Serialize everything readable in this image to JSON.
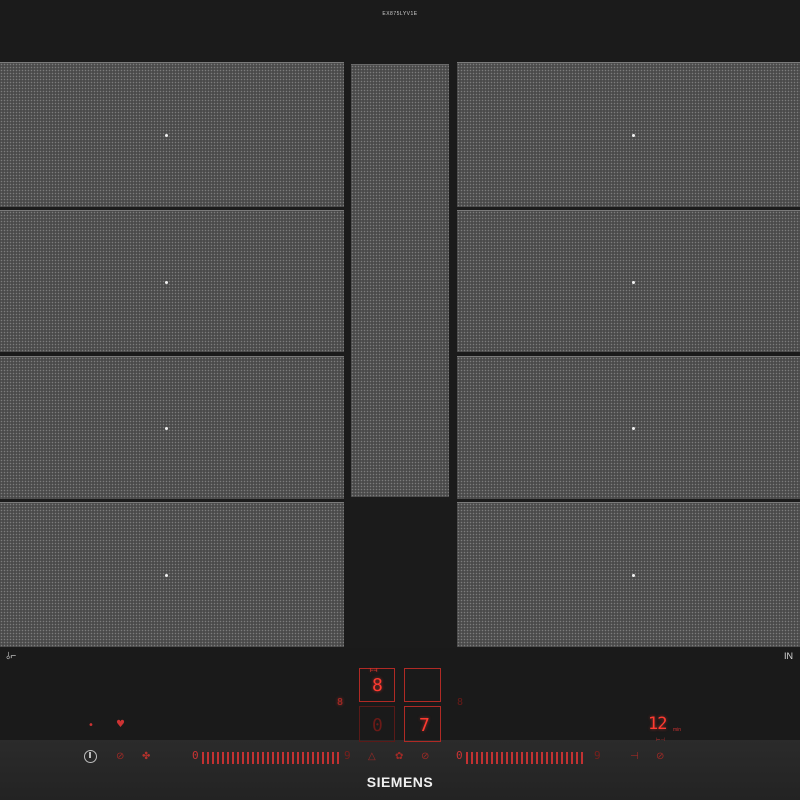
{
  "cooktop": {
    "model_code": "EX875LYV1E",
    "brand": "SIEMENS",
    "flex_indicator": "IN",
    "left_indicator_icon": "pan-detect-icon"
  },
  "displays": {
    "upper_left_digit": "8",
    "upper_right_digit": "",
    "lower_left_digit": "0",
    "lower_right_digit": "7",
    "timer_value": "12",
    "timer_unit": "min",
    "timer_sub": "⊢⊣",
    "side_marker": "8"
  },
  "controls": {
    "power_icon": "power-icon",
    "slider_left_start": "0",
    "slider_left_end": "9",
    "slider_right_start": "0",
    "slider_right_end": "9",
    "icons": [
      "childlock-icon",
      "heart-icon",
      "power-boost-icon",
      "fan-icon"
    ]
  },
  "colors": {
    "zone_gray": "#4a4a4a",
    "glass_black": "#1b1b1b",
    "indicator_red": "#ff3a30"
  }
}
